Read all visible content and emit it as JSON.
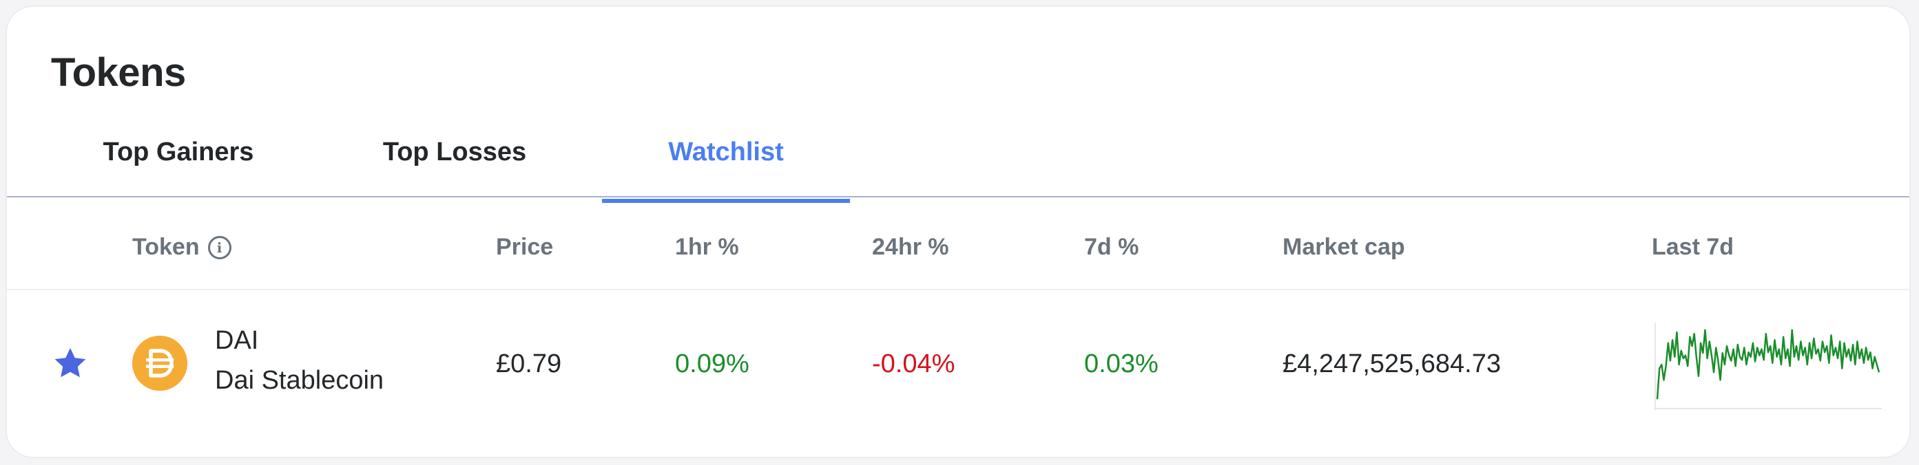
{
  "header": {
    "title": "Tokens"
  },
  "tabs": [
    {
      "label": "Top Gainers",
      "active": false
    },
    {
      "label": "Top Losses",
      "active": false
    },
    {
      "label": "Watchlist",
      "active": true
    }
  ],
  "columns": {
    "token": "Token",
    "price": "Price",
    "h1": "1hr %",
    "h24": "24hr %",
    "d7": "7d %",
    "market_cap": "Market cap",
    "last7d": "Last 7d"
  },
  "icons": {
    "info": "info-icon",
    "star": "star-icon",
    "coin": "dai-logo-icon"
  },
  "colors": {
    "accent": "#4a7ff0",
    "positive": "#1a8d2a",
    "negative": "#d6121b",
    "star": "#4a67e0",
    "dai": "#f5ac37"
  },
  "rows": [
    {
      "symbol": "DAI",
      "name": "Dai Stablecoin",
      "price": "£0.79",
      "change_1h": "0.09%",
      "change_24h": "-0.04%",
      "change_7d": "0.03%",
      "market_cap": "£4,247,525,684.73",
      "watchlisted": true,
      "sparkline": [
        0.05,
        0.45,
        0.5,
        0.3,
        0.48,
        0.78,
        0.55,
        0.82,
        0.6,
        0.92,
        0.5,
        0.68,
        0.58,
        0.62,
        0.48,
        0.86,
        0.74,
        0.9,
        0.6,
        0.35,
        0.78,
        0.65,
        0.95,
        0.58,
        0.8,
        0.62,
        0.4,
        0.72,
        0.55,
        0.3,
        0.65,
        0.5,
        0.74,
        0.62,
        0.55,
        0.7,
        0.48,
        0.76,
        0.6,
        0.56,
        0.72,
        0.5,
        0.66,
        0.6,
        0.78,
        0.54,
        0.72,
        0.62,
        0.7,
        0.56,
        0.9,
        0.66,
        0.74,
        0.52,
        0.82,
        0.6,
        0.7,
        0.5,
        0.86,
        0.58,
        0.7,
        0.48,
        0.95,
        0.6,
        0.74,
        0.56,
        0.8,
        0.62,
        0.72,
        0.5,
        0.78,
        0.58,
        0.84,
        0.64,
        0.7,
        0.55,
        0.8,
        0.66,
        0.74,
        0.52,
        0.88,
        0.62,
        0.72,
        0.58,
        0.8,
        0.45,
        0.78,
        0.6,
        0.7,
        0.55,
        0.76,
        0.5,
        0.8,
        0.58,
        0.7,
        0.52,
        0.72,
        0.56,
        0.66,
        0.45,
        0.6,
        0.5,
        0.4
      ]
    }
  ]
}
